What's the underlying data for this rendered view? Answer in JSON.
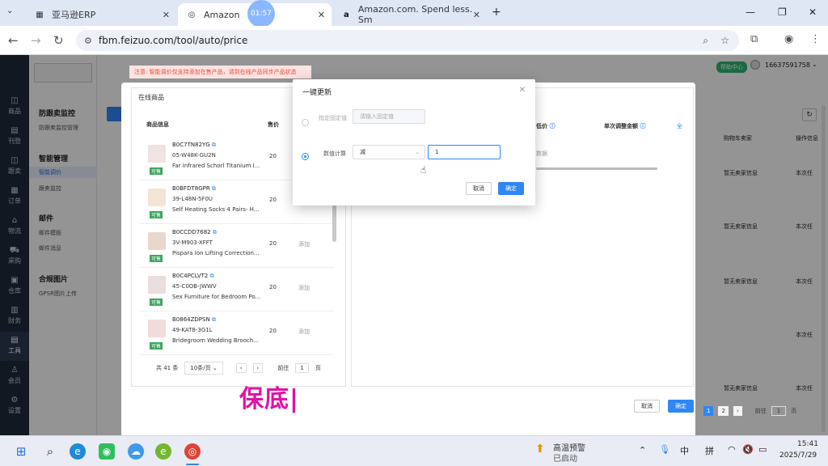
{
  "browser": {
    "tabs": [
      {
        "title": "亚马逊ERP"
      },
      {
        "title": "Amazon"
      },
      {
        "title": "Amazon.com. Spend less. Sm"
      }
    ],
    "url": "fbm.feizuo.com/tool/auto/price",
    "timer": "01:57"
  },
  "rail": [
    {
      "icon": "◫",
      "label": "商品"
    },
    {
      "icon": "▤",
      "label": "刊登"
    },
    {
      "icon": "◫",
      "label": "跟卖"
    },
    {
      "icon": "▦",
      "label": "订单"
    },
    {
      "icon": "⌂",
      "label": "物流"
    },
    {
      "icon": "⛟",
      "label": "采购"
    },
    {
      "icon": "▣",
      "label": "仓库"
    },
    {
      "icon": "▥",
      "label": "财务"
    },
    {
      "icon": "▤",
      "label": "工具"
    },
    {
      "icon": "♙",
      "label": "会员"
    },
    {
      "icon": "⚙",
      "label": "设置"
    }
  ],
  "submenu": {
    "groups": [
      {
        "title": "防跟卖监控",
        "items": [
          "防跟卖监控管理"
        ]
      },
      {
        "title": "智能管理",
        "items": [
          "智能调价",
          "跟卖监控"
        ]
      },
      {
        "title": "邮件",
        "items": [
          "邮件模板",
          "邮件消息"
        ]
      },
      {
        "title": "合规图片",
        "items": [
          "GPSR图片上传"
        ]
      }
    ]
  },
  "header": {
    "help": "帮助中心",
    "phone": "16637591758"
  },
  "warning": "注意: 智能调价仅支持添加在售产品，请到在线产品同步产品状态",
  "online_panel": {
    "title": "在线商品",
    "col_info": "商品信息",
    "col_price": "售价",
    "products": [
      {
        "asin": "B0C7TN82YG",
        "sku": "05-W48K-GU2N",
        "name": "Far Infrared Schorl Titanium I...",
        "tag": "可售",
        "price": "20",
        "add": ""
      },
      {
        "asin": "B0BFDT8GPR",
        "sku": "39-L48N-5F0U",
        "name": "Self Heating Socks 4 Pairs- H...",
        "tag": "可售",
        "price": "20",
        "add": ""
      },
      {
        "asin": "B0CCDD7682",
        "sku": "3V-M903-XFFT",
        "name": "Pispara Ion Lifting Correction...",
        "tag": "可售",
        "price": "20",
        "add": "添加"
      },
      {
        "asin": "B0C4PCLVT2",
        "sku": "45-C0OB-JWWV",
        "name": "Sex Furniture for Bedroom Po...",
        "tag": "可售",
        "price": "20",
        "add": "添加"
      },
      {
        "asin": "B0864ZDPSN",
        "sku": "49-KAT8-3G1L",
        "name": "Bridegroom Wedding Brooch...",
        "tag": "可售",
        "price": "20",
        "add": "添加"
      }
    ],
    "pager": {
      "total": "共 41 条",
      "size": "10条/页",
      "goto": "前往",
      "page": "1",
      "unit": "页"
    }
  },
  "right_panel": {
    "col_low": "低价",
    "col_adjust": "单次调整金额",
    "col_more": "全",
    "nodata": "数据",
    "cancel": "取消",
    "confirm": "确定"
  },
  "bg_list": {
    "col_seller": "购物车卖家",
    "col_op": "操作信息",
    "rows": [
      {
        "seller": "暂无卖家信息",
        "op": "本次任"
      },
      {
        "seller": "暂无卖家信息",
        "op": "本次任"
      },
      {
        "seller": "暂无卖家信息",
        "op": "本次任"
      },
      {
        "seller": "",
        "op": "本次任"
      },
      {
        "seller": "暂无卖家信息",
        "op": "本次任"
      }
    ],
    "pages": [
      "1",
      "2"
    ],
    "goto": "前往",
    "page": "1",
    "unit": "页"
  },
  "dialog": {
    "title": "一键更新",
    "fixed_label": "指定固定值",
    "fixed_placeholder": "请输入固定值",
    "calc_label": "数值计算",
    "op_value": "减",
    "amount_value": "1",
    "cancel": "取消",
    "confirm": "确定"
  },
  "subtitle": "保底|",
  "taskbar": {
    "weather_title": "高温预警",
    "weather_sub": "已启动",
    "ime1": "中",
    "ime2": "拼",
    "time": "15:41",
    "date": "2025/7/29"
  }
}
